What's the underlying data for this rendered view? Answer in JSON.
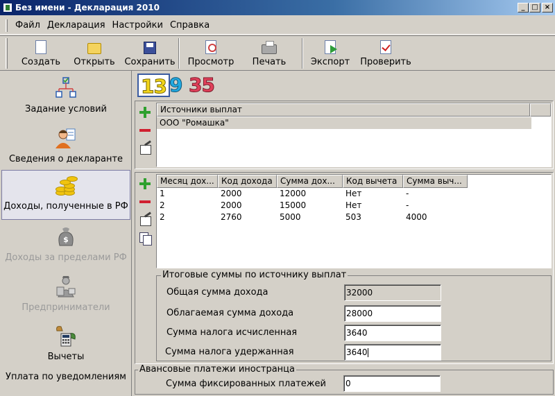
{
  "window": {
    "title": "Без имени - Декларация 2010",
    "controls": [
      "_",
      "□",
      "×"
    ]
  },
  "menu": [
    "Файл",
    "Декларация",
    "Настройки",
    "Справка"
  ],
  "toolbar": {
    "create": "Создать",
    "open": "Открыть",
    "save": "Сохранить",
    "preview": "Просмотр",
    "print": "Печать",
    "export": "Экспорт",
    "check": "Проверить"
  },
  "sidebar": {
    "items": [
      {
        "label": "Задание условий",
        "icon": "conditions-icon"
      },
      {
        "label": "Сведения о декларанте",
        "icon": "person-icon"
      },
      {
        "label": "Доходы, полученные в РФ",
        "icon": "coins-icon"
      },
      {
        "label": "Доходы за пределами РФ",
        "icon": "money-bag-icon"
      },
      {
        "label": "Предприниматели",
        "icon": "entrepreneur-icon"
      },
      {
        "label": "Вычеты",
        "icon": "calculator-icon"
      },
      {
        "label": "Уплата по уведомлениям",
        "icon": ""
      }
    ]
  },
  "rate_tabs": [
    {
      "label": "13",
      "color": "#f1d41a"
    },
    {
      "label": "9",
      "color": "#22a9e0"
    },
    {
      "label": "35",
      "color": "#e0405a"
    }
  ],
  "sources": {
    "header": "Источники выплат",
    "rows": [
      "ООО \"Ромашка\""
    ]
  },
  "income": {
    "columns": [
      "Месяц дох...",
      "Код дохода",
      "Сумма дох...",
      "Код вычета",
      "Сумма выч..."
    ],
    "rows": [
      [
        "1",
        "2000",
        "12000",
        "Нет",
        "-"
      ],
      [
        "2",
        "2000",
        "15000",
        "Нет",
        "-"
      ],
      [
        "2",
        "2760",
        "5000",
        "503",
        "4000"
      ]
    ]
  },
  "totals": {
    "legend": "Итоговые суммы по источнику выплат",
    "total_income_label": "Общая сумма дохода",
    "total_income": "32000",
    "taxable_income_label": "Облагаемая сумма дохода",
    "taxable_income": "28000",
    "tax_calculated_label": "Сумма налога исчисленная",
    "tax_calculated": "3640",
    "tax_withheld_label": "Сумма налога удержанная",
    "tax_withheld": "3640"
  },
  "foreigner": {
    "legend": "Авансовые платежи иностранца",
    "fixed_payments_label": "Сумма фиксированных платежей",
    "fixed_payments": "0"
  }
}
